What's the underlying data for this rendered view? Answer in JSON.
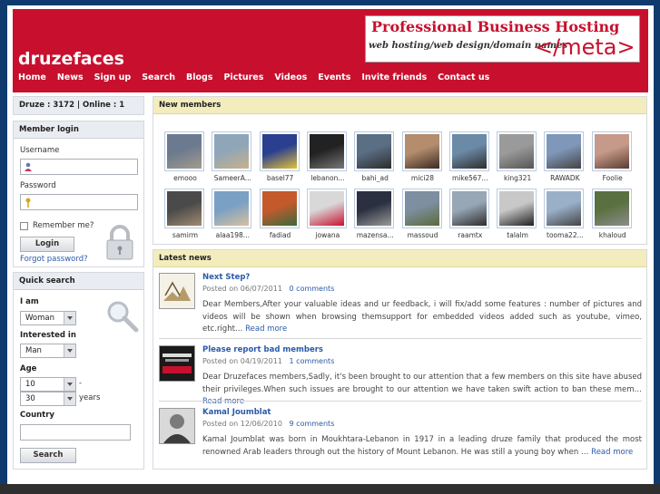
{
  "site": {
    "logo": "druzefaces"
  },
  "banner": {
    "line1": "Professional Business Hosting",
    "line2": "web hosting/web design/domain names",
    "line3": "</meta>"
  },
  "nav": [
    "Home",
    "News",
    "Sign up",
    "Search",
    "Blogs",
    "Pictures",
    "Videos",
    "Events",
    "Invite friends",
    "Contact us"
  ],
  "stats": {
    "text": "Druze : 3172 | Online : 1"
  },
  "login": {
    "title": "Member login",
    "username_label": "Username",
    "password_label": "Password",
    "remember_label": "Remember me?",
    "login_button": "Login",
    "forgot_link": "Forgot password?"
  },
  "quick_search": {
    "title": "Quick search",
    "iam_label": "I am",
    "iam_value": "Woman",
    "interested_label": "Interested in",
    "interested_value": "Man",
    "age_label": "Age",
    "age_from": "10",
    "age_dash": "-",
    "age_to": "30",
    "age_unit": "years",
    "country_label": "Country",
    "search_button": "Search"
  },
  "new_members": {
    "title": "New members",
    "row1": [
      "emooo",
      "SameerA...",
      "basel77",
      "lebanon...",
      "bahi_ad",
      "mici28",
      "mike567...",
      "king321",
      "RAWADK",
      "Foolie"
    ],
    "row2": [
      "samirm",
      "alaa198...",
      "fadiad",
      "jowana",
      "mazensa...",
      "massoud",
      "raamtx",
      "talalm",
      "tooma22...",
      "khaloud"
    ]
  },
  "latest_news": {
    "title": "Latest news",
    "posted_label": "Posted on",
    "read_more": "Read more",
    "items": [
      {
        "title": "Next Step?",
        "date": "06/07/2011",
        "comments": "0 comments",
        "body": "Dear Members,After your valuable ideas and ur feedback, i will fix/add some features : number of pictures and videos will be shown when browsing themsupport for embedded videos added such as youtube, vimeo, etc.right…"
      },
      {
        "title": "Please report bad members",
        "date": "04/19/2011",
        "comments": "1 comments",
        "body": "Dear Druzefaces members,Sadly, it's been brought to our attention that a few members on this site have abused their privileges.When such issues are brought to our attention we have taken swift action to ban these mem…"
      },
      {
        "title": "Kamal Joumblat",
        "date": "12/06/2010",
        "comments": "9 comments",
        "body": "Kamal Joumblat was born in Moukhtara-Lebanon in 1917 in a leading druze family that produced the most renowned Arab leaders through out the history of Mount Lebanon. He was still a young boy when …"
      }
    ]
  },
  "colors": {
    "brand": "#c8102e",
    "page_bg": "#0e3a6e",
    "link": "#2a5aa8",
    "header_box": "#e9ecf1",
    "yellow_header": "#f3edbd"
  }
}
